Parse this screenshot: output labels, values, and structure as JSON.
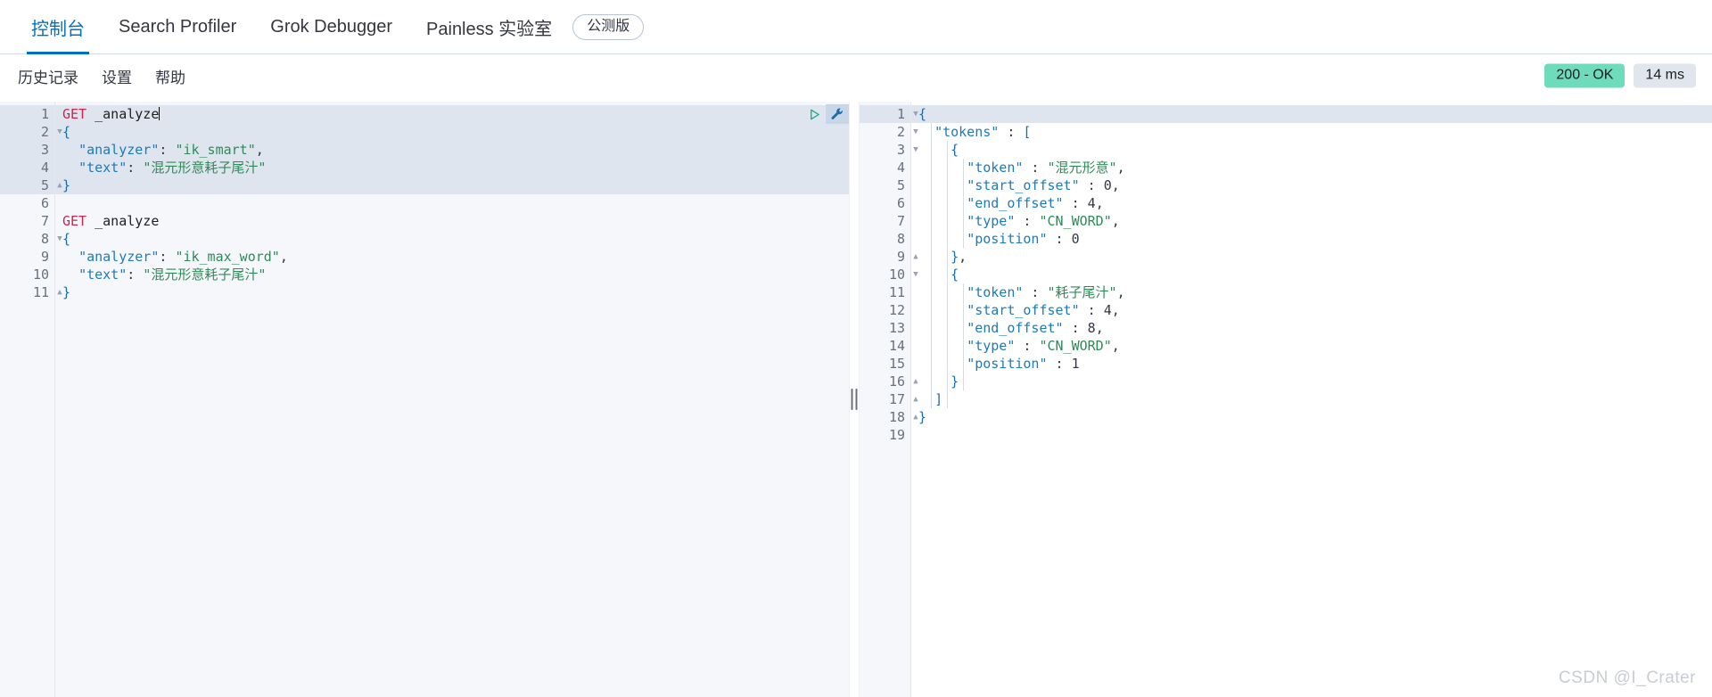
{
  "top_tabs": [
    {
      "label": "控制台",
      "active": true
    },
    {
      "label": "Search Profiler",
      "active": false
    },
    {
      "label": "Grok Debugger",
      "active": false
    },
    {
      "label": "Painless 实验室",
      "active": false
    }
  ],
  "beta_badge": "公测版",
  "submenu": [
    "历史记录",
    "设置",
    "帮助"
  ],
  "status": {
    "response_code": "200 - OK",
    "response_time": "14 ms",
    "ok_color": "#6edbbb",
    "time_color": "#e0e5ee"
  },
  "editor": {
    "icons": {
      "run": "play-icon",
      "wrench": "wrench-icon"
    },
    "highlighted_lines": [
      1,
      2,
      3,
      4,
      5
    ],
    "fold_markers": {
      "2": "open",
      "5": "close",
      "8": "open",
      "11": "close"
    },
    "lines": [
      {
        "n": 1,
        "tokens": [
          {
            "t": "GET ",
            "c": "k-method"
          },
          {
            "t": "_analyze",
            "c": "k-url"
          }
        ],
        "caret": true
      },
      {
        "n": 2,
        "tokens": [
          {
            "t": "{",
            "c": "k-brace"
          }
        ]
      },
      {
        "n": 3,
        "tokens": [
          {
            "t": "  ",
            "c": "k-punc"
          },
          {
            "t": "\"analyzer\"",
            "c": "k-key"
          },
          {
            "t": ": ",
            "c": "k-punc"
          },
          {
            "t": "\"ik_smart\"",
            "c": "k-str"
          },
          {
            "t": ",",
            "c": "k-punc"
          }
        ]
      },
      {
        "n": 4,
        "tokens": [
          {
            "t": "  ",
            "c": "k-punc"
          },
          {
            "t": "\"text\"",
            "c": "k-key"
          },
          {
            "t": ": ",
            "c": "k-punc"
          },
          {
            "t": "\"混元形意耗子尾汁\"",
            "c": "k-str"
          }
        ]
      },
      {
        "n": 5,
        "tokens": [
          {
            "t": "}",
            "c": "k-brace"
          }
        ]
      },
      {
        "n": 6,
        "tokens": [
          {
            "t": "",
            "c": "k-punc"
          }
        ]
      },
      {
        "n": 7,
        "tokens": [
          {
            "t": "GET ",
            "c": "k-method"
          },
          {
            "t": "_analyze",
            "c": "k-url"
          }
        ]
      },
      {
        "n": 8,
        "tokens": [
          {
            "t": "{",
            "c": "k-brace"
          }
        ]
      },
      {
        "n": 9,
        "tokens": [
          {
            "t": "  ",
            "c": "k-punc"
          },
          {
            "t": "\"analyzer\"",
            "c": "k-key"
          },
          {
            "t": ": ",
            "c": "k-punc"
          },
          {
            "t": "\"ik_max_word\"",
            "c": "k-str"
          },
          {
            "t": ",",
            "c": "k-punc"
          }
        ]
      },
      {
        "n": 10,
        "tokens": [
          {
            "t": "  ",
            "c": "k-punc"
          },
          {
            "t": "\"text\"",
            "c": "k-key"
          },
          {
            "t": ": ",
            "c": "k-punc"
          },
          {
            "t": "\"混元形意耗子尾汁\"",
            "c": "k-str"
          }
        ]
      },
      {
        "n": 11,
        "tokens": [
          {
            "t": "}",
            "c": "k-brace"
          }
        ]
      }
    ]
  },
  "response": {
    "highlighted_lines": [
      1
    ],
    "fold_markers": {
      "1": "open",
      "2": "open",
      "3": "open",
      "9": "close",
      "10": "open",
      "16": "close",
      "17": "close",
      "18": "close"
    },
    "lines": [
      {
        "n": 1,
        "tokens": [
          {
            "t": "{",
            "c": "k-brace"
          }
        ]
      },
      {
        "n": 2,
        "tokens": [
          {
            "t": "  ",
            "c": "k-punc"
          },
          {
            "t": "\"tokens\"",
            "c": "k-key"
          },
          {
            "t": " : ",
            "c": "k-punc"
          },
          {
            "t": "[",
            "c": "k-brace"
          }
        ]
      },
      {
        "n": 3,
        "tokens": [
          {
            "t": "    ",
            "c": "k-punc"
          },
          {
            "t": "{",
            "c": "k-brace"
          }
        ]
      },
      {
        "n": 4,
        "tokens": [
          {
            "t": "      ",
            "c": "k-punc"
          },
          {
            "t": "\"token\"",
            "c": "k-key"
          },
          {
            "t": " : ",
            "c": "k-punc"
          },
          {
            "t": "\"混元形意\"",
            "c": "k-str"
          },
          {
            "t": ",",
            "c": "k-punc"
          }
        ]
      },
      {
        "n": 5,
        "tokens": [
          {
            "t": "      ",
            "c": "k-punc"
          },
          {
            "t": "\"start_offset\"",
            "c": "k-key"
          },
          {
            "t": " : ",
            "c": "k-punc"
          },
          {
            "t": "0",
            "c": "k-num"
          },
          {
            "t": ",",
            "c": "k-punc"
          }
        ]
      },
      {
        "n": 6,
        "tokens": [
          {
            "t": "      ",
            "c": "k-punc"
          },
          {
            "t": "\"end_offset\"",
            "c": "k-key"
          },
          {
            "t": " : ",
            "c": "k-punc"
          },
          {
            "t": "4",
            "c": "k-num"
          },
          {
            "t": ",",
            "c": "k-punc"
          }
        ]
      },
      {
        "n": 7,
        "tokens": [
          {
            "t": "      ",
            "c": "k-punc"
          },
          {
            "t": "\"type\"",
            "c": "k-key"
          },
          {
            "t": " : ",
            "c": "k-punc"
          },
          {
            "t": "\"CN_WORD\"",
            "c": "k-str"
          },
          {
            "t": ",",
            "c": "k-punc"
          }
        ]
      },
      {
        "n": 8,
        "tokens": [
          {
            "t": "      ",
            "c": "k-punc"
          },
          {
            "t": "\"position\"",
            "c": "k-key"
          },
          {
            "t": " : ",
            "c": "k-punc"
          },
          {
            "t": "0",
            "c": "k-num"
          }
        ]
      },
      {
        "n": 9,
        "tokens": [
          {
            "t": "    ",
            "c": "k-punc"
          },
          {
            "t": "}",
            "c": "k-brace"
          },
          {
            "t": ",",
            "c": "k-punc"
          }
        ]
      },
      {
        "n": 10,
        "tokens": [
          {
            "t": "    ",
            "c": "k-punc"
          },
          {
            "t": "{",
            "c": "k-brace"
          }
        ]
      },
      {
        "n": 11,
        "tokens": [
          {
            "t": "      ",
            "c": "k-punc"
          },
          {
            "t": "\"token\"",
            "c": "k-key"
          },
          {
            "t": " : ",
            "c": "k-punc"
          },
          {
            "t": "\"耗子尾汁\"",
            "c": "k-str"
          },
          {
            "t": ",",
            "c": "k-punc"
          }
        ]
      },
      {
        "n": 12,
        "tokens": [
          {
            "t": "      ",
            "c": "k-punc"
          },
          {
            "t": "\"start_offset\"",
            "c": "k-key"
          },
          {
            "t": " : ",
            "c": "k-punc"
          },
          {
            "t": "4",
            "c": "k-num"
          },
          {
            "t": ",",
            "c": "k-punc"
          }
        ]
      },
      {
        "n": 13,
        "tokens": [
          {
            "t": "      ",
            "c": "k-punc"
          },
          {
            "t": "\"end_offset\"",
            "c": "k-key"
          },
          {
            "t": " : ",
            "c": "k-punc"
          },
          {
            "t": "8",
            "c": "k-num"
          },
          {
            "t": ",",
            "c": "k-punc"
          }
        ]
      },
      {
        "n": 14,
        "tokens": [
          {
            "t": "      ",
            "c": "k-punc"
          },
          {
            "t": "\"type\"",
            "c": "k-key"
          },
          {
            "t": " : ",
            "c": "k-punc"
          },
          {
            "t": "\"CN_WORD\"",
            "c": "k-str"
          },
          {
            "t": ",",
            "c": "k-punc"
          }
        ]
      },
      {
        "n": 15,
        "tokens": [
          {
            "t": "      ",
            "c": "k-punc"
          },
          {
            "t": "\"position\"",
            "c": "k-key"
          },
          {
            "t": " : ",
            "c": "k-punc"
          },
          {
            "t": "1",
            "c": "k-num"
          }
        ]
      },
      {
        "n": 16,
        "tokens": [
          {
            "t": "    ",
            "c": "k-punc"
          },
          {
            "t": "}",
            "c": "k-brace"
          }
        ]
      },
      {
        "n": 17,
        "tokens": [
          {
            "t": "  ",
            "c": "k-punc"
          },
          {
            "t": "]",
            "c": "k-brace"
          }
        ]
      },
      {
        "n": 18,
        "tokens": [
          {
            "t": "}",
            "c": "k-brace"
          }
        ]
      },
      {
        "n": 19,
        "tokens": [
          {
            "t": "",
            "c": "k-punc"
          }
        ]
      }
    ]
  },
  "watermark": "CSDN @I_Crater"
}
